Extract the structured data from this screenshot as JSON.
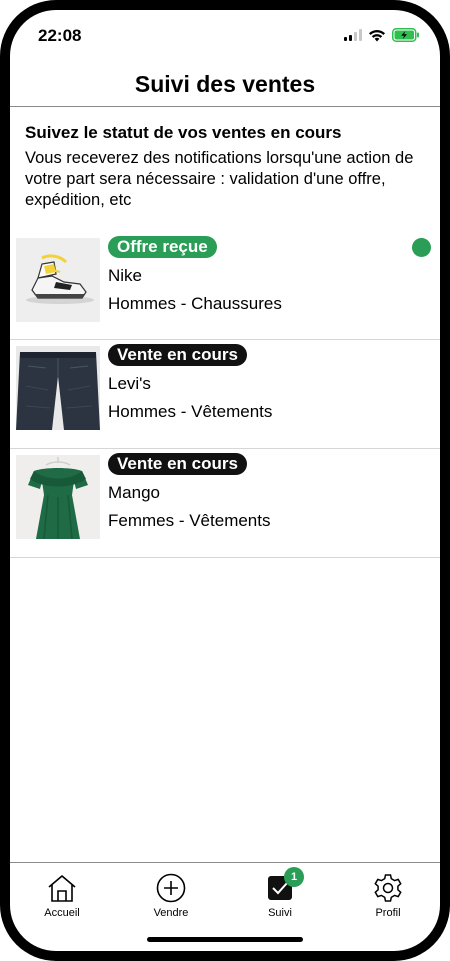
{
  "status_bar": {
    "time": "22:08",
    "icons": [
      "cellular-signal-icon",
      "wifi-icon",
      "battery-charging-icon"
    ]
  },
  "header": {
    "title": "Suivi des ventes"
  },
  "intro": {
    "title": "Suivez le statut de vos ventes en cours",
    "text": "Vous receverez des notifications lorsqu'une action de votre part sera nécessaire : validation d'une offre, expédition, etc"
  },
  "sales": [
    {
      "status": "Offre reçue",
      "status_color": "#2a9d57",
      "brand": "Nike",
      "category": "Hommes - Chaussures",
      "image": "sneakers-photo",
      "has_notification": true
    },
    {
      "status": "Vente en cours",
      "status_color": "#111111",
      "brand": "Levi's",
      "category": "Hommes - Vêtements",
      "image": "jeans-photo",
      "has_notification": false
    },
    {
      "status": "Vente en cours",
      "status_color": "#111111",
      "brand": "Mango",
      "category": "Femmes - Vêtements",
      "image": "green-dress-photo",
      "has_notification": false
    }
  ],
  "tab_bar": {
    "tabs": [
      {
        "label": "Accueil",
        "icon": "home-icon"
      },
      {
        "label": "Vendre",
        "icon": "plus-circle-icon"
      },
      {
        "label": "Suivi",
        "icon": "checkbox-icon",
        "badge": "1",
        "active": true
      },
      {
        "label": "Profil",
        "icon": "gear-icon"
      }
    ]
  },
  "colors": {
    "accent_green": "#2a9d57",
    "badge_black": "#111111"
  }
}
